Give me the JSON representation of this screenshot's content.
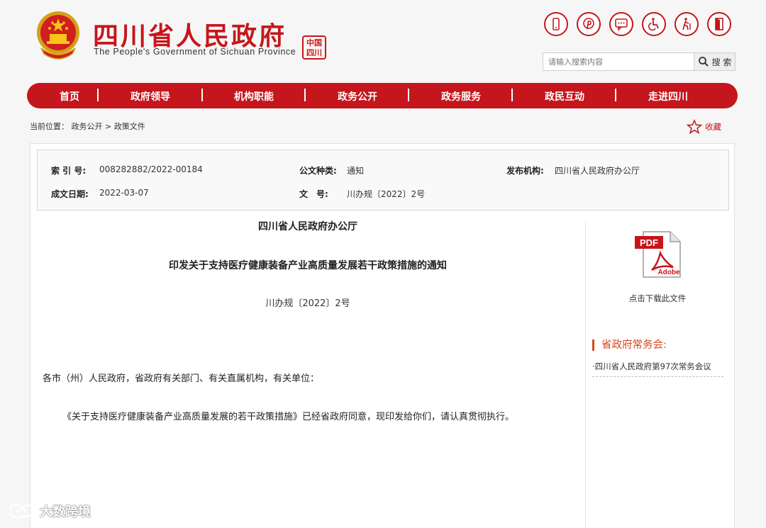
{
  "header": {
    "site_name": "四川省人民政府",
    "site_name_en": "The People's Government of Sichuan Province",
    "seal_text": "中国四川",
    "search": {
      "placeholder": "请输入搜索内容",
      "button_label": "搜 索"
    },
    "tool_icons": [
      "mobile-icon",
      "weibo-icon",
      "chat-icon",
      "accessibility-icon",
      "elderly-icon",
      "exit-icon"
    ]
  },
  "nav": {
    "items": [
      "首页",
      "政府领导",
      "机构职能",
      "政务公开",
      "政务服务",
      "政民互动",
      "走进四川"
    ],
    "separator": "|"
  },
  "breadcrumb": {
    "prefix": "当前位置：",
    "items": [
      "政务公开",
      "政策文件"
    ],
    "separator": ">"
  },
  "bookmark": {
    "label": "收藏"
  },
  "meta": {
    "index_label": "索 引 号:",
    "index_value": "008282882/2022-00184",
    "type_label": "公文种类:",
    "type_value": "通知",
    "org_label": "发布机构:",
    "org_value": "四川省人民政府办公厅",
    "date_label": "成文日期:",
    "date_value": "2022-03-07",
    "docno_label": "文　号:",
    "docno_value": "川办规〔2022〕2号"
  },
  "article": {
    "org": "四川省人民政府办公厅",
    "title": "印发关于支持医疗健康装备产业高质量发展若干政策措施的通知",
    "doc_number": "川办规〔2022〕2号",
    "salutation": "各市（州）人民政府，省政府有关部门、有关直属机构，有关单位：",
    "paragraph_1": "《关于支持医疗健康装备产业高质量发展的若干政策措施》已经省政府同意，现印发给你们，请认真贯彻执行。"
  },
  "sidebar": {
    "pdf_label": "PDF",
    "pdf_brand": "Adobe",
    "download_label": "点击下载此文件",
    "section_title": "省政府常务会:",
    "meeting_link": "·四川省人民政府第97次常务会议"
  },
  "watermark": {
    "text": "大数跨境"
  },
  "colors": {
    "brand_red": "#c4161c",
    "accent_orange": "#d6481e"
  }
}
